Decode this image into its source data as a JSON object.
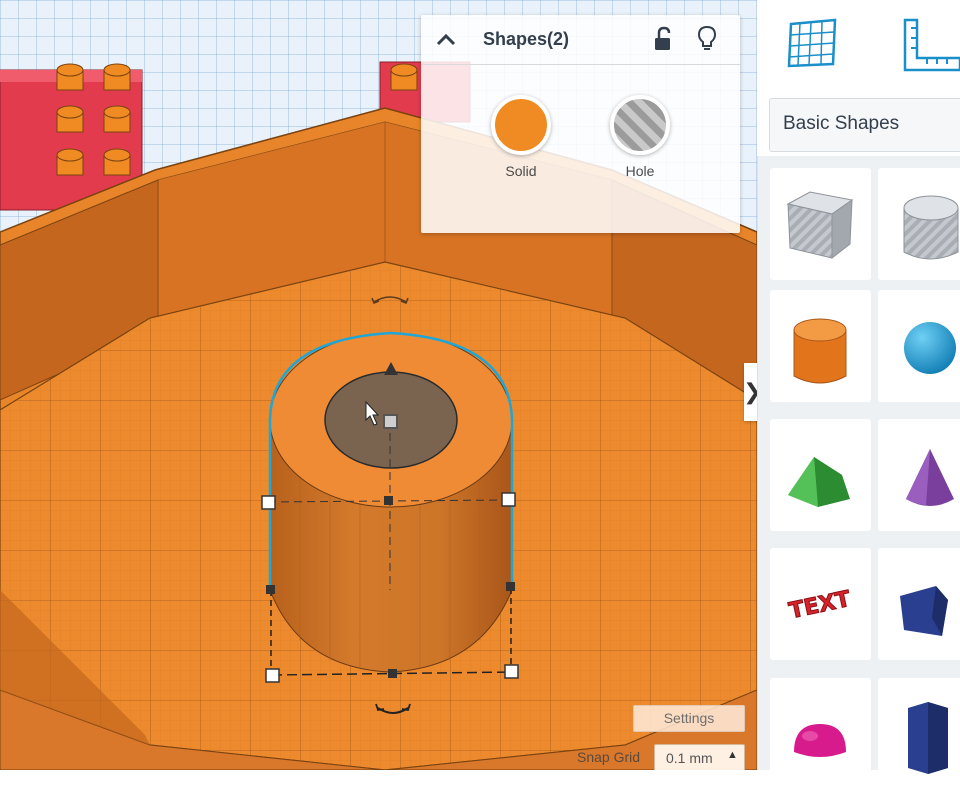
{
  "inspector": {
    "title": "Shapes(2)",
    "solid_label": "Solid",
    "hole_label": "Hole",
    "icons": [
      "chevron-up-icon",
      "unlock-icon",
      "lightbulb-icon"
    ]
  },
  "right_panel": {
    "library_label": "Basic Shapes",
    "top_icons": [
      "workplane-icon",
      "ruler-icon"
    ],
    "shapes": [
      {
        "name": "box-hole",
        "color": "#b7bcc4"
      },
      {
        "name": "cylinder-hole",
        "color": "#b7bcc4"
      },
      {
        "name": "box",
        "color": "#f07e1b"
      },
      {
        "name": "sphere",
        "color": "#1ba1dc"
      },
      {
        "name": "roof",
        "color": "#3aa83e"
      },
      {
        "name": "cone",
        "color": "#7a3e9d"
      },
      {
        "name": "text",
        "color": "#d6232a"
      },
      {
        "name": "polygon",
        "color": "#2a3f8f"
      },
      {
        "name": "half-sphere",
        "color": "#d81b8c"
      },
      {
        "name": "hexagonal-prism",
        "color": "#2a3f8f"
      }
    ],
    "shape_text_label": "TEXT"
  },
  "bottom_bar": {
    "settings_label": "Settings",
    "snap_grid_label": "Snap Grid",
    "snap_grid_value": "0.1 mm"
  },
  "colors": {
    "workplane_orange": "#e8842a",
    "selection_outline": "#1ea7d6",
    "lego_red": "#e33b4e",
    "accent_blue": "#1a8fc9"
  }
}
